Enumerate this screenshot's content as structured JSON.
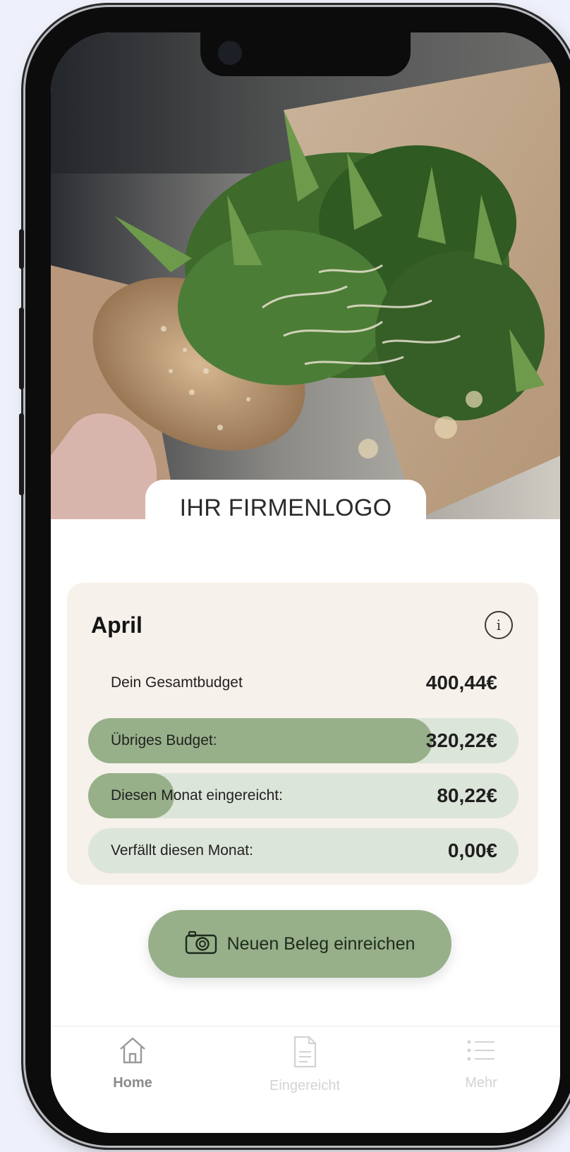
{
  "header": {
    "logo_text": "IHR FIRMENLOGO"
  },
  "budget_card": {
    "month": "April",
    "info_icon": "info-icon",
    "rows": [
      {
        "label": "Dein Gesamtbudget",
        "value": "400,44€"
      },
      {
        "label": "Übriges Budget:",
        "value": "320,22€",
        "fill_fraction": 0.8
      },
      {
        "label": "Diesen Monat eingereicht:",
        "value": "80,22€",
        "fill_fraction": 0.2
      },
      {
        "label": "Verfällt diesen Monat:",
        "value": "0,00€",
        "fill_fraction": 0
      }
    ]
  },
  "action": {
    "label": "Neuen Beleg einreichen",
    "icon": "camera-icon"
  },
  "tabbar": {
    "items": [
      {
        "label": "Home",
        "icon": "home-icon",
        "active": true
      },
      {
        "label": "Eingereicht",
        "icon": "receipt-icon",
        "active": false
      },
      {
        "label": "Mehr",
        "icon": "list-icon",
        "active": false
      }
    ]
  },
  "colors": {
    "accent": "#97b08a",
    "bar_track": "#dce5d9",
    "card_bg": "#f6f1ea",
    "inactive_tab": "#d3d3d3",
    "active_tab": "#8a8a8a"
  }
}
